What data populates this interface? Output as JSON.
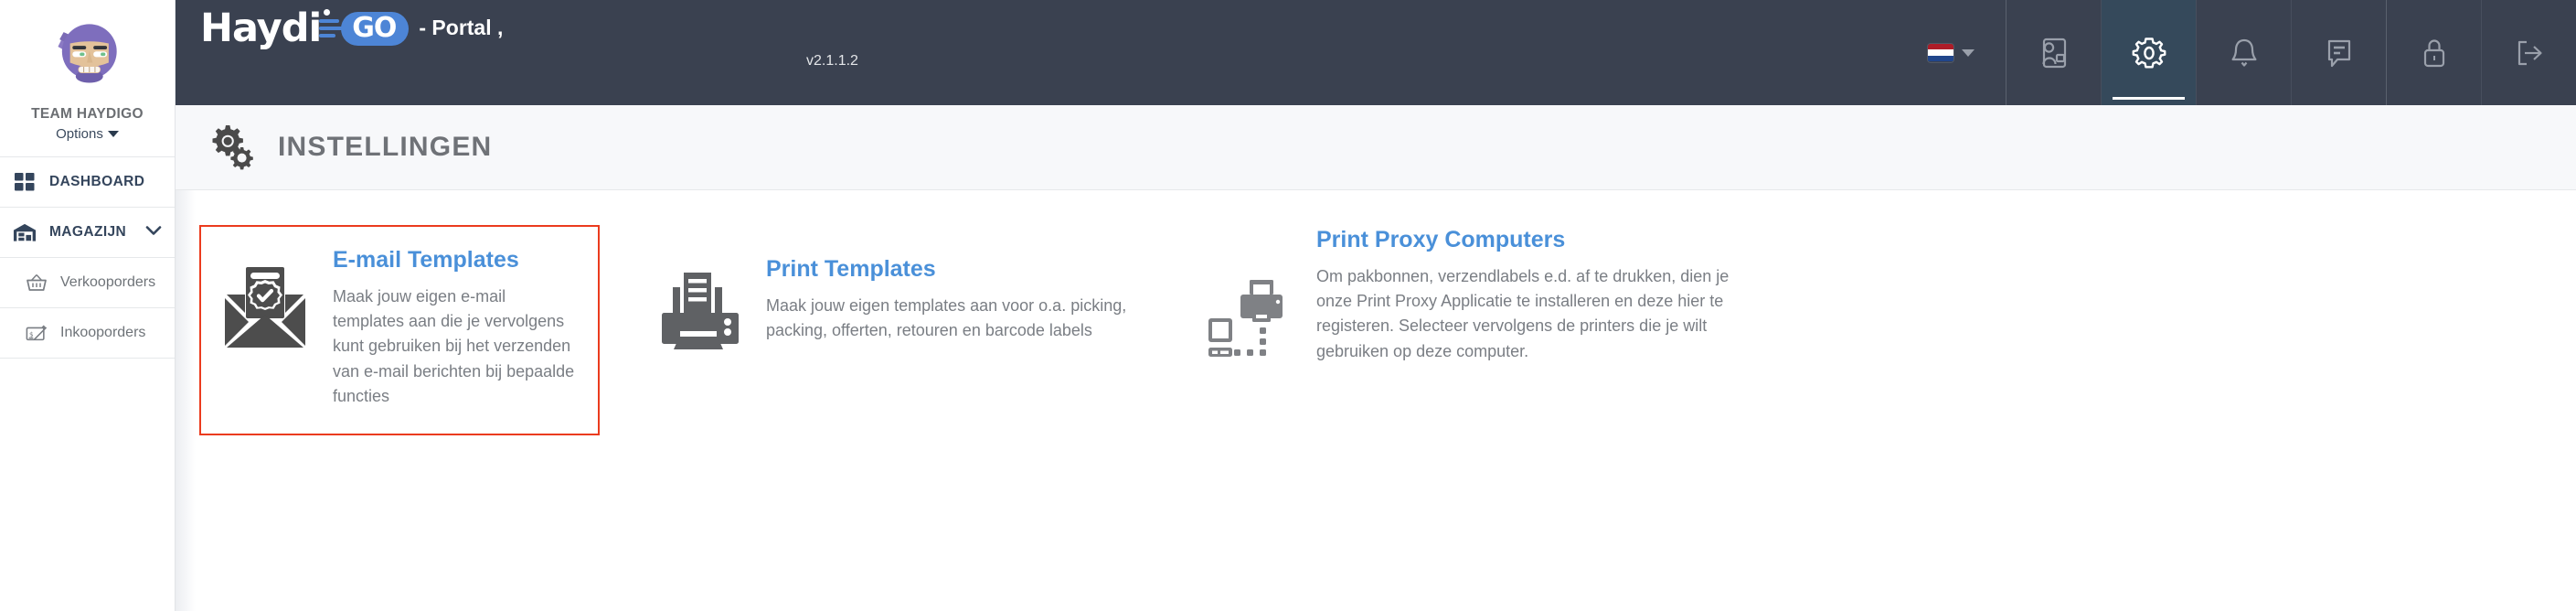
{
  "sidebar": {
    "avatar_name": "ninja-avatar",
    "team_name": "TEAM HAYDIGO",
    "options_label": "Options",
    "items": [
      {
        "label": "DASHBOARD",
        "icon": "grid-icon",
        "level": "top",
        "chevron": ""
      },
      {
        "label": "MAGAZIJN",
        "icon": "warehouse-icon",
        "level": "top",
        "chevron": "⌄"
      },
      {
        "label": "Verkooporders",
        "icon": "basket-icon",
        "level": "sub",
        "chevron": ""
      },
      {
        "label": "Inkooporders",
        "icon": "invoice-icon",
        "level": "sub",
        "chevron": ""
      }
    ]
  },
  "topbar": {
    "logo_haydi": "Haydi",
    "logo_go": "GO",
    "portal_text": "- Portal ,",
    "version": "v2.1.1.2",
    "language": {
      "flag": "netherlands-flag",
      "name": "language-selector"
    },
    "buttons": [
      {
        "name": "contacts-icon",
        "active": false
      },
      {
        "name": "gear-icon",
        "active": true
      },
      {
        "name": "bell-icon",
        "active": false
      },
      {
        "name": "chat-icon",
        "active": false
      },
      {
        "name": "lock-icon",
        "active": false
      },
      {
        "name": "logout-icon",
        "active": false
      }
    ]
  },
  "page": {
    "title": "INSTELLINGEN",
    "title_icon": "gears-icon"
  },
  "cards": [
    {
      "icon": "email-envelope-certificate-icon",
      "title": "E-mail Templates",
      "description": "Maak jouw eigen e-mail templates aan die je vervolgens kunt gebruiken bij het verzenden van e-mail berichten bij bepaalde functies",
      "highlighted": true,
      "highlight_color": "#eb3b1e"
    },
    {
      "icon": "printer-icon",
      "title": "Print Templates",
      "description": "Maak jouw eigen templates aan voor o.a. picking, packing, offerten, retouren en barcode labels",
      "highlighted": false,
      "highlight_color": ""
    },
    {
      "icon": "print-proxy-computer-icon",
      "title": "Print Proxy Computers",
      "description": "Om pakbonnen, verzendlabels e.d. af te drukken, dien je onze Print Proxy Applicatie te installeren en deze hier te registeren. Selecteer vervolgens de printers die je wilt gebruiken op deze computer.",
      "highlighted": false,
      "highlight_color": ""
    }
  ],
  "colors": {
    "header_bg": "#3a4150",
    "header_active": "#35495b",
    "accent_blue": "#4a90d9",
    "logo_blue": "#4d85d6",
    "highlight_red": "#eb3b1e",
    "nav_text": "#34455c",
    "body_text": "#7a7e84"
  }
}
